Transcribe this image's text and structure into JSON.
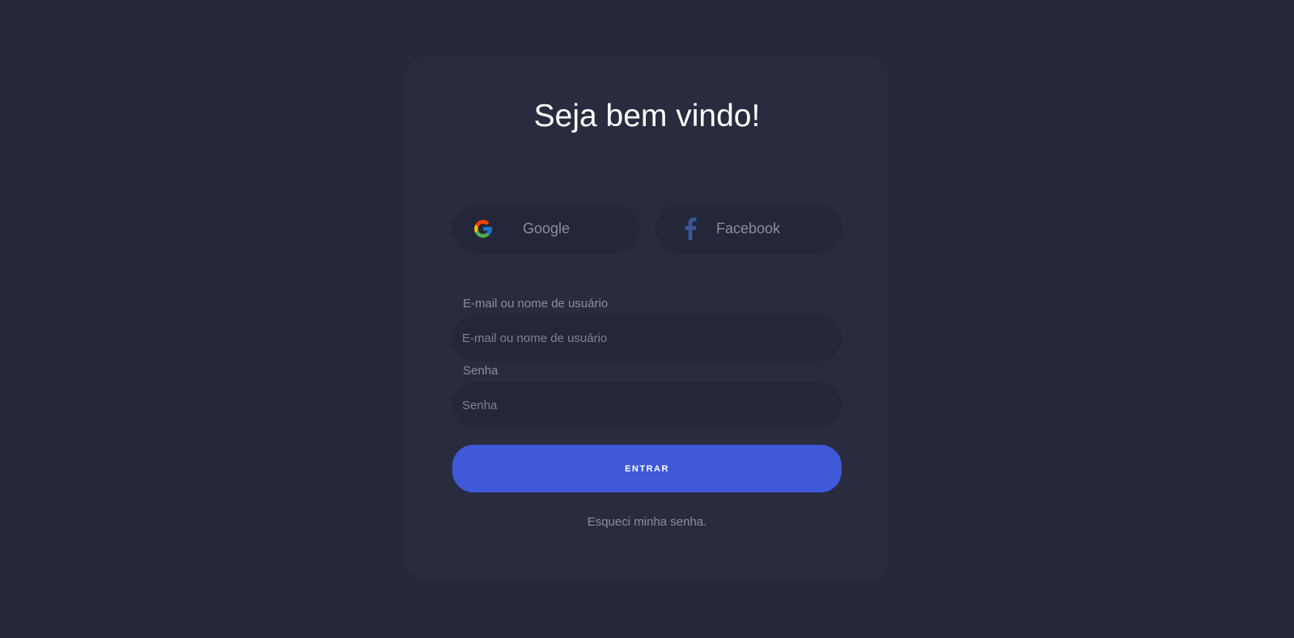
{
  "login": {
    "title": "Seja bem vindo!",
    "social": {
      "google_label": "Google",
      "google_icon": "google-icon",
      "facebook_label": "Facebook",
      "facebook_icon": "facebook-icon",
      "facebook_color": "#3b5998"
    },
    "email": {
      "label": "E-mail ou nome de usuário",
      "placeholder": "E-mail ou nome de usuário",
      "value": ""
    },
    "password": {
      "label": "Senha",
      "placeholder": "Senha",
      "value": ""
    },
    "submit_label": "ENTRAR",
    "forgot_label": "Esqueci minha senha."
  },
  "colors": {
    "background": "#252837",
    "card": "#292c3e",
    "field": "#24273a",
    "accent": "#3f59d9",
    "muted_text": "#8b8e9d"
  }
}
